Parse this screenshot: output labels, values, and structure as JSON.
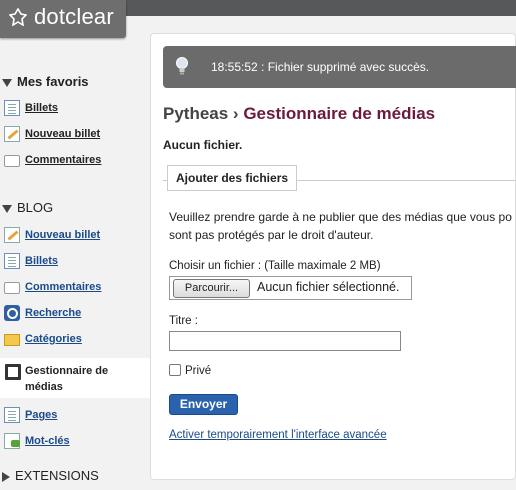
{
  "brand": {
    "name": "dotclear"
  },
  "sidebar": {
    "favorites": {
      "title": "Mes favoris",
      "items": [
        {
          "label": "Billets",
          "icon": "document-icon"
        },
        {
          "label": "Nouveau billet",
          "icon": "pencil-icon"
        },
        {
          "label": "Commentaires",
          "icon": "comment-icon"
        }
      ]
    },
    "blog": {
      "title": "BLOG",
      "items": [
        {
          "label": "Nouveau billet",
          "icon": "pencil-icon"
        },
        {
          "label": "Billets",
          "icon": "document-icon"
        },
        {
          "label": "Commentaires",
          "icon": "comment-icon"
        },
        {
          "label": "Recherche",
          "icon": "search-icon"
        },
        {
          "label": "Catégories",
          "icon": "folder-icon"
        },
        {
          "label": "Gestionnaire de médias",
          "icon": "media-icon",
          "active": true
        },
        {
          "label": "Pages",
          "icon": "document-icon"
        },
        {
          "label": "Mot-clés",
          "icon": "tag-icon"
        }
      ]
    },
    "extensions": {
      "title": "EXTENSIONS"
    }
  },
  "notice": {
    "text": "18:55:52 : Fichier supprimé avec succès."
  },
  "breadcrumb": {
    "parent": "Pytheas",
    "separator": " › ",
    "current": "Gestionnaire de médias"
  },
  "main": {
    "empty_text": "Aucun fichier.",
    "upload": {
      "legend": "Ajouter des fichiers",
      "warning": "Veuillez prendre garde à ne publier que des médias que vous po sont pas protégés par le droit d'auteur.",
      "choose_label": "Choisir un fichier : (Taille maximale 2 MB)",
      "browse_button": "Parcourir...",
      "file_status": "Aucun fichier sélectionné.",
      "title_label": "Titre :",
      "title_value": "",
      "private_label": "Privé",
      "private_checked": false,
      "submit_button": "Envoyer",
      "advanced_link": "Activer temporairement l'interface avancée"
    }
  },
  "colors": {
    "accent": "#2a62ad",
    "breadcrumb_current": "#6b1a3d",
    "notice_bg": "#6b6b6b",
    "topbar": "#575859"
  }
}
